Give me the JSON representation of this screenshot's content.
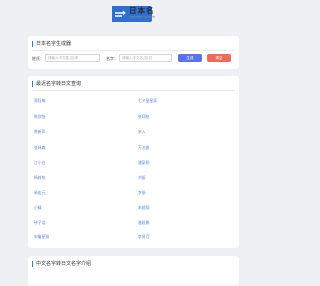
{
  "header": {
    "logo_title": "日本名",
    "logo_sub": "ribenming.com"
  },
  "generator": {
    "title": "日本名字生成器",
    "surname_label": "姓氏：",
    "surname_placeholder": "请输入中文姓,如:李",
    "given_label": "名字：",
    "given_placeholder": "请输入中文名,如:白",
    "generate_label": "生成",
    "clear_label": "清空"
  },
  "recent": {
    "title": "最近名字转日文查询",
    "left": [
      "郑钰楠",
      "陈欣怡",
      "陈新声",
      "张玮森",
      "江小白",
      "杨梓铭",
      "易宏元",
      "小晴",
      "钟子浩",
      "申屠星翔"
    ],
    "right": [
      "七夕星星雨",
      "张翊铭",
      "宋入",
      "万泊俊",
      "潘豪翔",
      "刘振",
      "李振",
      "朱竣翔",
      "潘娅娜",
      "李贤月"
    ]
  },
  "intro": {
    "title": "中文名字转日文名字介绍"
  }
}
